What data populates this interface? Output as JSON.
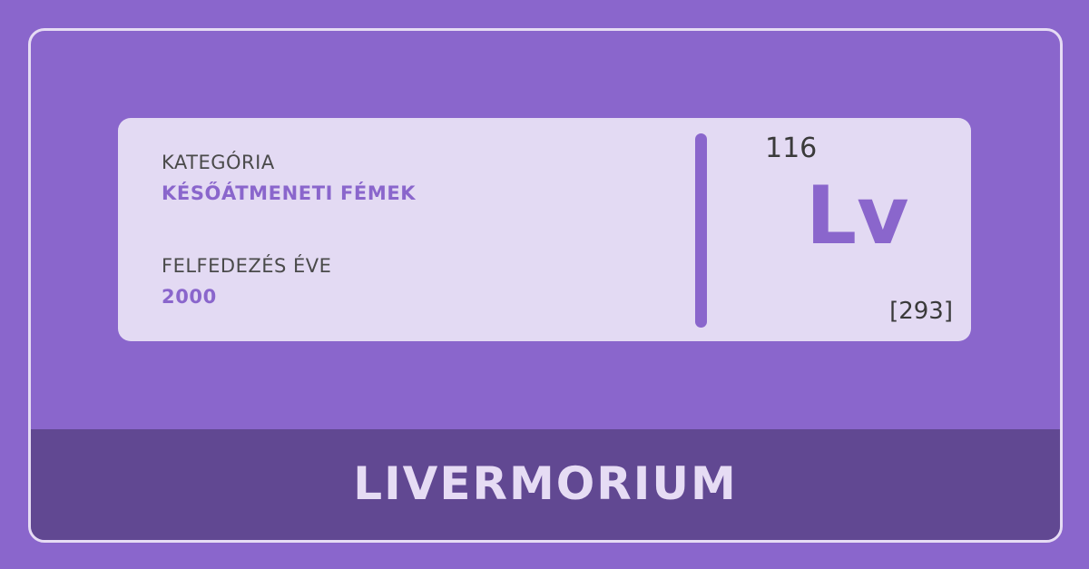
{
  "card": {
    "category_label": "KATEGÓRIA",
    "category_value": "KÉSŐÁTMENETI FÉMEK",
    "discovery_label": "FELFEDEZÉS ÉVE",
    "discovery_value": "2000",
    "atomic_number": "116",
    "symbol": "Lv",
    "atomic_mass": "[293]"
  },
  "banner": {
    "name": "LIVERMORIUM"
  },
  "colors": {
    "background": "#8a66cc",
    "card": "#e3daf3",
    "banner": "#614892",
    "accent": "#8a66cc",
    "text_dark": "#3a3a3a",
    "text_light": "#e6dcf4"
  }
}
